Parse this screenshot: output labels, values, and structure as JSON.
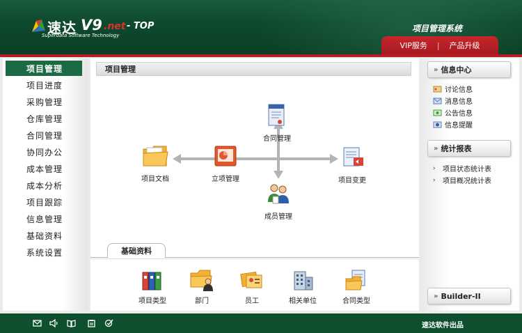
{
  "header": {
    "logo_cn": "速达",
    "logo_v9": "V9",
    "logo_net": ".net",
    "logo_top": "- TOP",
    "logo_sub": "Superdata Software Technology",
    "system_title": "项目管理系统",
    "nav": {
      "vip": "VIP服务",
      "separator": "|",
      "upgrade": "产品升级"
    }
  },
  "sidebar": {
    "items": [
      {
        "label": "项目管理",
        "active": true
      },
      {
        "label": "项目进度"
      },
      {
        "label": "采购管理"
      },
      {
        "label": "仓库管理"
      },
      {
        "label": "合同管理"
      },
      {
        "label": "协同办公"
      },
      {
        "label": "成本管理"
      },
      {
        "label": "成本分析"
      },
      {
        "label": "项目跟踪"
      },
      {
        "label": "信息管理"
      },
      {
        "label": "基础资料"
      },
      {
        "label": "系统设置"
      }
    ]
  },
  "main": {
    "title": "项目管理",
    "flow": {
      "contract_mgmt": "合同管理",
      "project_docs": "项目文档",
      "project_setup": "立项管理",
      "project_change": "项目变更",
      "member_mgmt": "成员管理"
    },
    "tab_label": "基础资料",
    "base_items": {
      "project_type": "项目类型",
      "department": "部门",
      "staff": "员工",
      "related_units": "相关单位",
      "contract_type": "合同类型"
    }
  },
  "right_panel": {
    "info_center": {
      "title": "信息中心",
      "links": [
        "讨论信息",
        "消息信息",
        "公告信息",
        "信息提醒"
      ]
    },
    "stats_report": {
      "title": "统计报表",
      "links": [
        "项目状态统计表",
        "项目概况统计表"
      ]
    },
    "builder": "Builder-II"
  },
  "footer": {
    "brand": "速达软件出品"
  },
  "colors": {
    "header_green": "#0e4a2e",
    "accent_red": "#b51d23",
    "active_nav": "#1a6b44"
  }
}
